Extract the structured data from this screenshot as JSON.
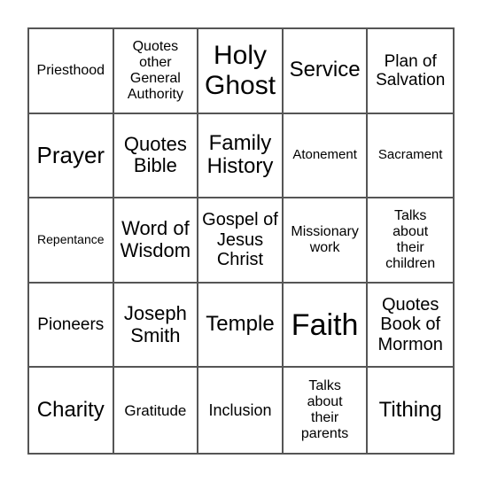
{
  "bingo_card": {
    "rows": [
      [
        {
          "text": "Priesthood",
          "size": "s16"
        },
        {
          "text": "Quotes other General Authority",
          "size": "s16"
        },
        {
          "text": "Holy Ghost",
          "size": "s30"
        },
        {
          "text": "Service",
          "size": "s24"
        },
        {
          "text": "Plan of Salvation",
          "size": "s19"
        }
      ],
      [
        {
          "text": "Prayer",
          "size": "s26"
        },
        {
          "text": "Quotes Bible",
          "size": "s22"
        },
        {
          "text": "Family History",
          "size": "s24"
        },
        {
          "text": "Atonement",
          "size": "s15"
        },
        {
          "text": "Sacrament",
          "size": "s15"
        }
      ],
      [
        {
          "text": "Repentance",
          "size": "s14"
        },
        {
          "text": "Word of Wisdom",
          "size": "s22"
        },
        {
          "text": "Gospel of Jesus Christ",
          "size": "s20"
        },
        {
          "text": "Missionary work",
          "size": "s16"
        },
        {
          "text": "Talks about their children",
          "size": "s16"
        }
      ],
      [
        {
          "text": "Pioneers",
          "size": "s19"
        },
        {
          "text": "Joseph Smith",
          "size": "s22"
        },
        {
          "text": "Temple",
          "size": "s24"
        },
        {
          "text": "Faith",
          "size": "s34"
        },
        {
          "text": "Quotes Book of Mormon",
          "size": "s20"
        }
      ],
      [
        {
          "text": "Charity",
          "size": "s24"
        },
        {
          "text": "Gratitude",
          "size": "s17"
        },
        {
          "text": "Inclusion",
          "size": "s18"
        },
        {
          "text": "Talks about their parents",
          "size": "s16"
        },
        {
          "text": "Tithing",
          "size": "s24"
        }
      ]
    ]
  }
}
